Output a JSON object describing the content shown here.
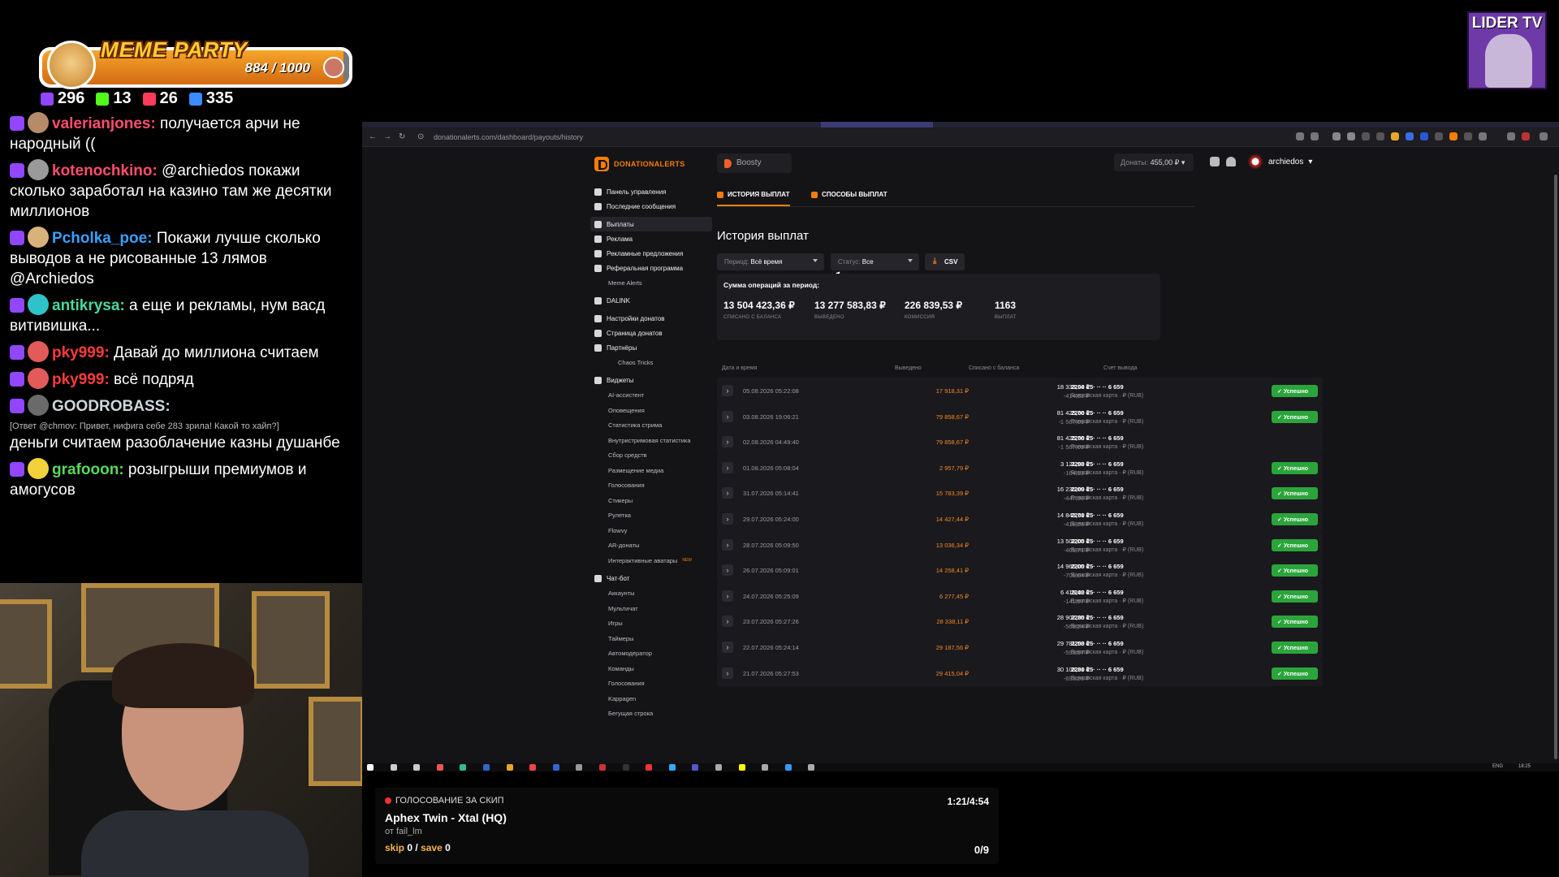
{
  "meme_party": {
    "title": "MEME PARTY",
    "count": "884 / 1000",
    "progress": 0.884
  },
  "stats": [
    {
      "icon": "twitch-icon",
      "value": "296",
      "color": "#9146ff"
    },
    {
      "icon": "kick-icon",
      "value": "13",
      "color": "#53fc18"
    },
    {
      "icon": "vk-icon",
      "value": "26",
      "color": "#ff3b5c"
    },
    {
      "icon": "viewers-icon",
      "value": "335",
      "color": "#3d8bff"
    }
  ],
  "lider": {
    "label": "LIDER TV"
  },
  "chat": [
    {
      "nick": "valerianjones:",
      "color": "#ff4d6d",
      "text": " получается арчи не народный ((",
      "av": "#b58b6a"
    },
    {
      "nick": "kotenochkino:",
      "color": "#ff4d6d",
      "text": " @archiedos покажи сколько заработал на казино там же десятки миллионов",
      "av": "#9a9a9a"
    },
    {
      "nick": "Pcholka_poe:",
      "color": "#3aa0ff",
      "text": " Покажи лучше сколько выводов а не рисованные 13 лямов @Archiedos",
      "av": "#d8b27a"
    },
    {
      "nick": "antikrysa:",
      "color": "#4ad8a0",
      "text": " а еще и рекламы, нум васд витивишка...",
      "av": "#2ec3c8"
    },
    {
      "nick": "pky999:",
      "color": "#ff3b3b",
      "text": " Давай до миллиона считаем",
      "av": "#e35a5a"
    },
    {
      "nick": "pky999:",
      "color": "#ff3b3b",
      "text": " всё подряд",
      "av": "#e35a5a"
    },
    {
      "nick": "GOODROBASS:",
      "color": "#cfd8dc",
      "text": "",
      "av": "#6a6a6a",
      "reply": "[Ответ @chmov: Привет, нифига себе 283 зрила! Какой то хайп?]",
      "cont": "деньги считаем разоблачение казны душанбе"
    },
    {
      "nick": "grafooon:",
      "color": "#5ad85a",
      "text": " розыгрыши премиумов и амогусов",
      "av": "#f2d23a"
    }
  ],
  "browser": {
    "url": "donationalerts.com/dashboard/payouts/history",
    "logo": "DONATIONALERTS",
    "boosty": "Boosty",
    "donats_label": "Донаты:",
    "donats_value": "455,00 ₽",
    "username": "archiedos",
    "sidebar": [
      {
        "label": "Панель управления",
        "type": "main"
      },
      {
        "label": "Последние сообщения",
        "type": "main"
      },
      {
        "label": "Выплаты",
        "type": "main",
        "active": true,
        "gap": true
      },
      {
        "label": "Реклама",
        "type": "main"
      },
      {
        "label": "Рекламные предложения",
        "type": "main"
      },
      {
        "label": "Реферальная программа",
        "type": "main"
      },
      {
        "label": "Meme Alerts",
        "type": "sub"
      },
      {
        "label": "DALINK",
        "type": "main",
        "gap": true
      },
      {
        "label": "Настройки донатов",
        "type": "main",
        "gap": true
      },
      {
        "label": "Страница донатов",
        "type": "main"
      },
      {
        "label": "Партнёры",
        "type": "main"
      },
      {
        "label": "Chaos Tricks",
        "type": "sub2"
      },
      {
        "label": "Виджеты",
        "type": "main",
        "gap": true
      },
      {
        "label": "AI-ассистент",
        "type": "sub"
      },
      {
        "label": "Оповещения",
        "type": "sub"
      },
      {
        "label": "Статистика стрима",
        "type": "sub"
      },
      {
        "label": "Внутристримовая статистика",
        "type": "sub"
      },
      {
        "label": "Сбор средств",
        "type": "sub"
      },
      {
        "label": "Размещение медиа",
        "type": "sub"
      },
      {
        "label": "Голосования",
        "type": "sub"
      },
      {
        "label": "Стикеры",
        "type": "sub"
      },
      {
        "label": "Рулетка",
        "type": "sub"
      },
      {
        "label": "Flowvy",
        "type": "sub"
      },
      {
        "label": "AR-донаты",
        "type": "sub"
      },
      {
        "label": "Интерактивные аватары",
        "type": "sub",
        "new": "NEW"
      },
      {
        "label": "Чат-бот",
        "type": "main",
        "gap": true
      },
      {
        "label": "Аккаунты",
        "type": "sub"
      },
      {
        "label": "Мультичат",
        "type": "sub"
      },
      {
        "label": "Игры",
        "type": "sub"
      },
      {
        "label": "Таймеры",
        "type": "sub"
      },
      {
        "label": "Автомодератор",
        "type": "sub"
      },
      {
        "label": "Команды",
        "type": "sub"
      },
      {
        "label": "Голосования",
        "type": "sub"
      },
      {
        "label": "Kappagen",
        "type": "sub"
      },
      {
        "label": "Бегущая строка",
        "type": "sub"
      }
    ],
    "tabs": {
      "history": "ИСТОРИЯ ВЫПЛАТ",
      "methods": "СПОСОБЫ ВЫПЛАТ"
    },
    "title": "История выплат",
    "period_label": "Период:",
    "period_value": "Всё время",
    "status_label": "Статус:",
    "status_value": "Все",
    "csv": "CSV",
    "summary": {
      "title": "Сумма операций за период:",
      "items": [
        {
          "value": "13 504 423,36 ₽",
          "label": "СПИСАНО С БАЛАНСА"
        },
        {
          "value": "13 277 583,83 ₽",
          "label": "ВЫВЕДЕНО"
        },
        {
          "value": "226 839,53 ₽",
          "label": "КОМИССИЯ"
        },
        {
          "value": "1163",
          "label": "ВЫПЛАТ"
        }
      ]
    },
    "columns": [
      "Дата и время",
      "Выведено",
      "Списано с баланса",
      "Счет вывода"
    ],
    "rows": [
      {
        "date": "05.08.2026 05:22:08",
        "out": "17 918,31 ₽",
        "debit": "18 333,14 ₽",
        "fee": "-414,82 ₽",
        "acc": "2200 15· ·· ·· 6 659",
        "acc_type": "Банковская карта · ₽ (RUB)",
        "status": "Успешно"
      },
      {
        "date": "03.08.2026 19:06:21",
        "out": "79 858,67 ₽",
        "debit": "81 425,76 ₽",
        "fee": "-1 567,09 ₽",
        "acc": "2200 15· ·· ·· 6 659",
        "acc_type": "Банковская карта · ₽ (RUB)",
        "status": "Успешно"
      },
      {
        "date": "02.08.2026 04:49:40",
        "out": "79 858,67 ₽",
        "debit": "81 425,76 ₽",
        "fee": "-1 567,09 ₽",
        "acc": "2200 15· ·· ·· 6 659",
        "acc_type": "Банковская карта · ₽ (RUB)",
        "status": ""
      },
      {
        "date": "01.08.2026 05:08:04",
        "out": "2 957,79 ₽",
        "debit": "3 121,93 ₽",
        "fee": "-164,13 ₽",
        "acc": "2200 15· ·· ·· 6 659",
        "acc_type": "Банковская карта · ₽ (RUB)",
        "status": "Успешно"
      },
      {
        "date": "31.07.2026 05:14:41",
        "out": "15 783,39 ₽",
        "debit": "16 230,69 ₽",
        "fee": "-447,30 ₽",
        "acc": "2200 15· ·· ·· 6 659",
        "acc_type": "Банковская карта · ₽ (RUB)",
        "status": "Успешно"
      },
      {
        "date": "29.07.2026 05:24:00",
        "out": "14 427,44 ₽",
        "debit": "14 843,71 ₽",
        "fee": "-416,26 ₽",
        "acc": "2200 15· ·· ·· 6 659",
        "acc_type": "Банковская карта · ₽ (RUB)",
        "status": "Успешно"
      },
      {
        "date": "28.07.2026 05:09:50",
        "out": "13 036,34 ₽",
        "debit": "13 502,05 ₽",
        "fee": "-465,71 ₽",
        "acc": "2200 15· ·· ·· 6 659",
        "acc_type": "Банковская карта · ₽ (RUB)",
        "status": "Успешно"
      },
      {
        "date": "26.07.2026 05:09:01",
        "out": "14 258,41 ₽",
        "debit": "14 965,05 ₽",
        "fee": "-706,64 ₽",
        "acc": "2200 15· ·· ·· 6 659",
        "acc_type": "Банковская карта · ₽ (RUB)",
        "status": "Успешно"
      },
      {
        "date": "24.07.2026 05:25:09",
        "out": "6 277,45 ₽",
        "debit": "6 419,42 ₽",
        "fee": "-141,97 ₽",
        "acc": "2200 15· ·· ·· 6 659",
        "acc_type": "Банковская карта · ₽ (RUB)",
        "status": "Успешно"
      },
      {
        "date": "23.07.2026 05:27:26",
        "out": "28 338,11 ₽",
        "debit": "28 907,35 ₽",
        "fee": "-569,24 ₽",
        "acc": "2200 15· ·· ·· 6 659",
        "acc_type": "Банковская карта · ₽ (RUB)",
        "status": "Успешно"
      },
      {
        "date": "22.07.2026 05:24:14",
        "out": "29 187,56 ₽",
        "debit": "29 781,53 ₽",
        "fee": "-593,97 ₽",
        "acc": "2200 15· ·· ·· 6 659",
        "acc_type": "Банковская карта · ₽ (RUB)",
        "status": "Успешно"
      },
      {
        "date": "21.07.2026 05:27:53",
        "out": "29 415,04 ₽",
        "debit": "30 108,31 ₽",
        "fee": "-693,26 ₽",
        "acc": "2200 15· ·· ·· 6 659",
        "acc_type": "Банковская карта · ₽ (RUB)",
        "status": "Успешно"
      }
    ],
    "taskbar": {
      "lang": "ENG",
      "time": "18:25"
    }
  },
  "song": {
    "header": "ГОЛОСОВАНИЕ ЗА СКИП",
    "title": "Aphex Twin - Xtal (HQ)",
    "author": "от fail_lm",
    "time": "1:21/4:54",
    "skip_label": "skip",
    "skip_value": "0",
    "save_label": "save",
    "save_value": "0",
    "votes": "0/9"
  }
}
